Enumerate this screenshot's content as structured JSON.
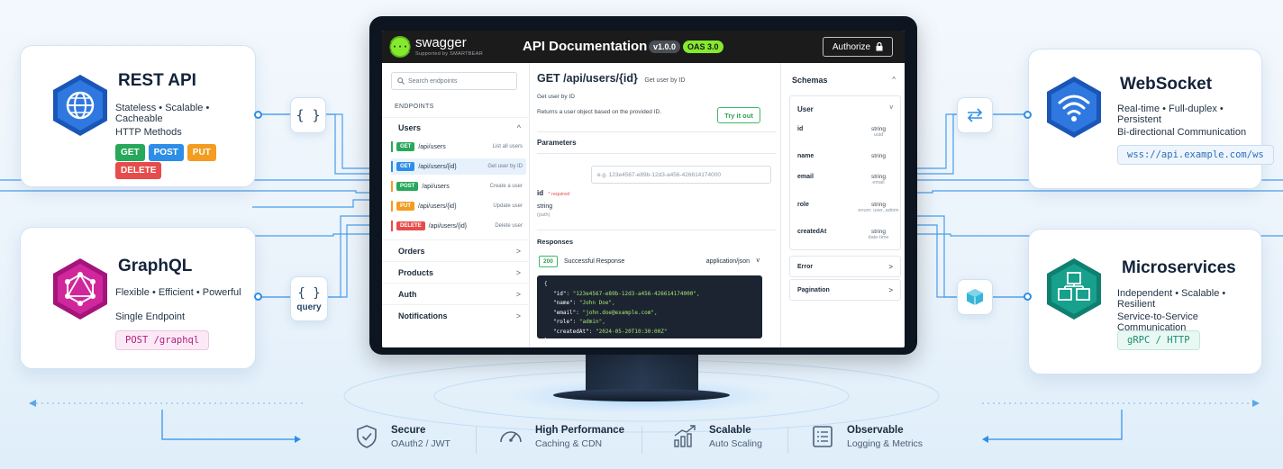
{
  "rest": {
    "title": "REST API",
    "tagline": "Stateless • Scalable • Cacheable",
    "methods_label": "HTTP Methods",
    "methods": [
      {
        "label": "GET",
        "color": "#27a85a"
      },
      {
        "label": "POST",
        "color": "#2d8ee8"
      },
      {
        "label": "PUT",
        "color": "#f39c1f"
      },
      {
        "label": "DELETE",
        "color": "#e74c4c"
      }
    ],
    "connector_icon": "curly-braces-icon",
    "connector_text": "{ }"
  },
  "graphql": {
    "title": "GraphQL",
    "tagline": "Flexible • Efficient • Powerful",
    "sub": "Single Endpoint",
    "code": "POST /graphql",
    "connector_text": "{ }",
    "connector_label": "query"
  },
  "websocket": {
    "title": "WebSocket",
    "tagline": "Real-time • Full-duplex • Persistent",
    "sub": "Bi-directional Communication",
    "code": "wss://api.example.com/ws",
    "connector_icon": "bidirectional-arrows-icon"
  },
  "microservices": {
    "title": "Microservices",
    "tagline": "Independent • Scalable • Resilient",
    "sub": "Service-to-Service Communication",
    "code": "gRPC / HTTP",
    "connector_icon": "cube-icon"
  },
  "swagger": {
    "logo_glyph": "{···}",
    "brand": "swagger",
    "brand_sub": "Supported by SMARTBEAR",
    "title": "API Documentation",
    "version": "v1.0.0",
    "oas": "OAS 3.0",
    "authorize": "Authorize",
    "search_placeholder": "Search endpoints",
    "endpoints_label": "ENDPOINTS",
    "groups": {
      "users": "Users",
      "orders": "Orders",
      "products": "Products",
      "auth": "Auth",
      "notifications": "Notifications"
    },
    "endpoints": [
      {
        "method": "GET",
        "color": "#27a85a",
        "path": "/api/users",
        "desc": "List all users"
      },
      {
        "method": "GET",
        "color": "#2d8ee8",
        "path": "/api/users/{id}",
        "desc": "Get user by ID"
      },
      {
        "method": "POST",
        "color": "#27a85a",
        "path": "/api/users",
        "desc": "Create a user"
      },
      {
        "method": "PUT",
        "color": "#f39c1f",
        "path": "/api/users/{id}",
        "desc": "Update user"
      },
      {
        "method": "DELETE",
        "color": "#e74c4c",
        "path": "/api/users/{id}",
        "desc": "Delete user"
      }
    ],
    "detail": {
      "title": "GET /api/users/{id}",
      "title_note": "Get user by ID",
      "summary": "Get user by ID",
      "description": "Returns a user object based on the provided ID.",
      "try_label": "Try it out",
      "parameters_label": "Parameters",
      "param_name": "id",
      "param_required": "* required",
      "param_type": "string",
      "param_in": "(path)",
      "param_placeholder": "e.g. 123e4567-e89b-12d3-a456-426614174000",
      "responses_label": "Responses",
      "status_code": "200",
      "status_text": "Successful Response",
      "content_type": "application/json",
      "json_lines": [
        {
          "key": "\"id\"",
          "value": "\"123e4567-e89b-12d3-a456-426614174000\","
        },
        {
          "key": "\"name\"",
          "value": "\"John Doe\","
        },
        {
          "key": "\"email\"",
          "value": "\"john.doe@example.com\","
        },
        {
          "key": "\"role\"",
          "value": "\"admin\","
        },
        {
          "key": "\"createdAt\"",
          "value": "\"2024-05-20T10:30:00Z\""
        }
      ]
    },
    "schemas": {
      "title": "Schemas",
      "user_label": "User",
      "fields": [
        {
          "name": "id",
          "type": "string",
          "sub": "uuid"
        },
        {
          "name": "name",
          "type": "string",
          "sub": ""
        },
        {
          "name": "email",
          "type": "string",
          "sub": "email"
        },
        {
          "name": "role",
          "type": "string",
          "sub": "enum: user, admin"
        },
        {
          "name": "createdAt",
          "type": "string",
          "sub": "date-time"
        }
      ],
      "error_label": "Error",
      "pagination_label": "Pagination"
    }
  },
  "features": [
    {
      "icon": "shield-check-icon",
      "title": "Secure",
      "sub": "OAuth2 / JWT"
    },
    {
      "icon": "speedometer-icon",
      "title": "High Performance",
      "sub": "Caching & CDN"
    },
    {
      "icon": "bar-chart-growth-icon",
      "title": "Scalable",
      "sub": "Auto Scaling"
    },
    {
      "icon": "checklist-icon",
      "title": "Observable",
      "sub": "Logging & Metrics"
    }
  ]
}
